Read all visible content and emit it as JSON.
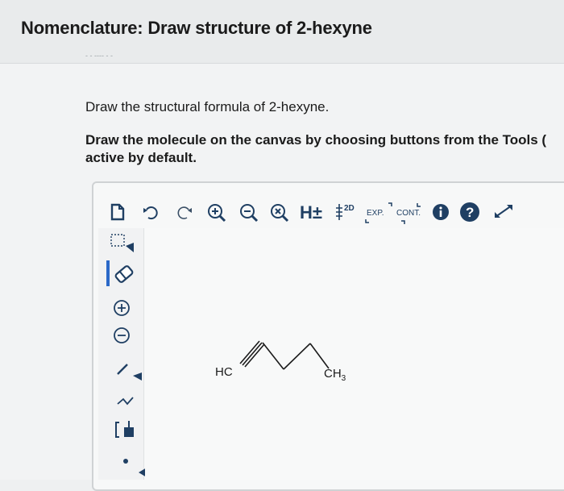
{
  "page": {
    "title": "Nomenclature: Draw structure of 2-hexyne",
    "subtitle": "- - ---- - -"
  },
  "instructions": {
    "line1": "Draw the structural formula of 2-hexyne.",
    "line2a": "Draw the molecule on the canvas by choosing buttons from the Tools (",
    "line2b": "active by default."
  },
  "toolbar": {
    "h_label": "H±",
    "twod_label": "2D",
    "exp_label": "EXP.",
    "cont_label": "CONT."
  },
  "molecule": {
    "left_label": "HC",
    "right_label": "CH",
    "right_sub": "3"
  },
  "colors": {
    "icon_dark": "#1f3f63",
    "select_blue": "#2b69c8"
  }
}
